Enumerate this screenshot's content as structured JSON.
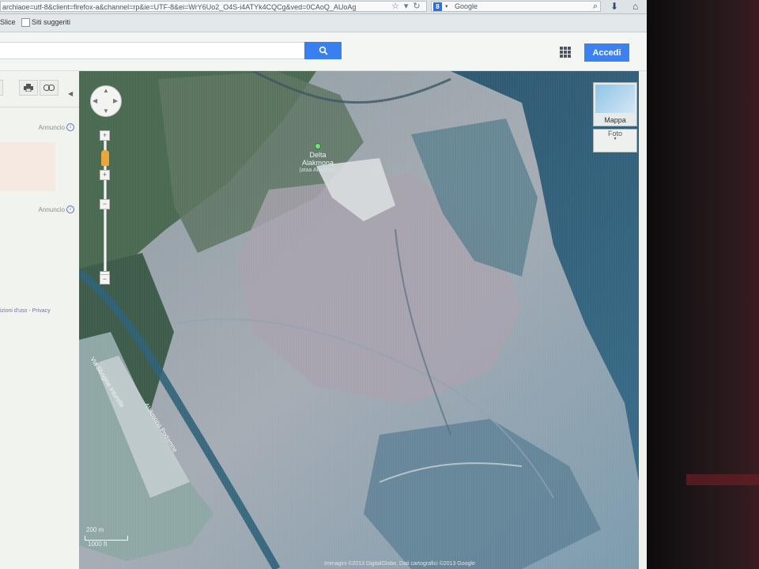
{
  "browser": {
    "url": "archiaoe=utf-8&client=firefox-a&channel=rp&ie=UTF-8&ei=WrY6Uo2_O4S-i4ATYk4CQCg&ved=0CAoQ_AUoAg",
    "search_placeholder": "Google",
    "search_engine_badge": "8"
  },
  "bookmarks": {
    "item1": "Slice",
    "item2": "Siti suggeriti"
  },
  "header": {
    "signin_label": "Accedi"
  },
  "sidebar": {
    "ad_label_1": "Annuncio",
    "ad_label_2": "Annuncio",
    "info_glyph": "i",
    "footer": "izioni d'uso - Privacy"
  },
  "map": {
    "place_name_line1": "Delta",
    "place_name_line2": "Alakmona",
    "place_sub": "(ataa Alakmon)",
    "road_label_1": "Via Sbrigine Inturelle",
    "road_label_2": "Alakmona Podamne",
    "maptype_label": "Mappa",
    "photo_label": "Foto",
    "photo_dropdown": "▾",
    "scale_metric": "200 m",
    "scale_imperial": "1000 ft",
    "attribution": "Immagini ©2013 DigitalGlobe, Dati cartografici ©2013 Google",
    "zoom_plus": "+",
    "zoom_minus": "−"
  },
  "colors": {
    "accent": "#3b82f0",
    "search_button": "#3a7ff0"
  }
}
